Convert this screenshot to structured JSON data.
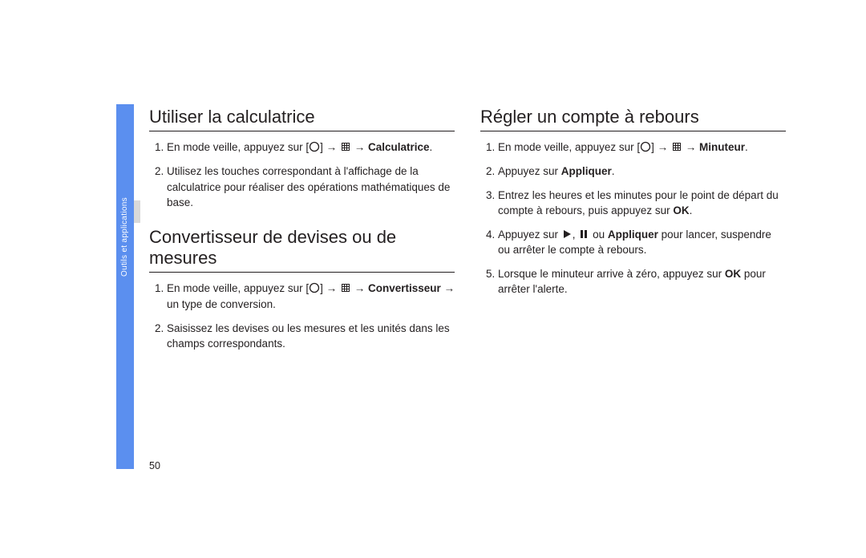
{
  "sidebar": {
    "label": "Outils et applications"
  },
  "page_number": "50",
  "glyphs": {
    "arrow": "→",
    "bracket_open": "[",
    "bracket_close": "]"
  },
  "left_column": {
    "section1": {
      "heading": "Utiliser la calculatrice",
      "item1_pre": "En mode veille, appuyez sur ",
      "item1_app": "Calculatrice",
      "item1_post": ".",
      "item2": "Utilisez les touches correspondant à l'affichage de la calculatrice pour réaliser des opérations mathématiques de base."
    },
    "section2": {
      "heading": "Convertisseur de devises ou de mesures",
      "item1_pre": "En mode veille, appuyez sur ",
      "item1_app": "Convertisseur",
      "item1_mid": " → un type de conversion.",
      "item2": "Saisissez les devises ou les mesures et les unités dans les champs correspondants."
    }
  },
  "right_column": {
    "section1": {
      "heading": "Régler un compte à rebours",
      "item1_pre": "En mode veille, appuyez sur ",
      "item1_app": "Minuteur",
      "item1_post": ".",
      "item2_pre": "Appuyez sur ",
      "item2_app": "Appliquer",
      "item2_post": ".",
      "item3_a": "Entrez les heures et les minutes pour le point de départ du compte à rebours, puis appuyez sur ",
      "item3_b": "OK",
      "item3_c": ".",
      "item4_a": "Appuyez sur ",
      "item4_b": ", ",
      "item4_c": " ou ",
      "item4_app": "Appliquer",
      "item4_d": " pour lancer, suspendre ou arrêter le compte à rebours.",
      "item5_a": "Lorsque le minuteur arrive à zéro, appuyez sur ",
      "item5_b": "OK",
      "item5_c": " pour arrêter l'alerte."
    }
  }
}
